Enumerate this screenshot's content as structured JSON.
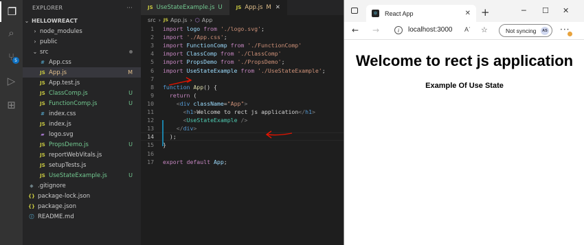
{
  "sidebar": {
    "title": "EXPLORER",
    "more": "···",
    "project": "HELLOWREACT",
    "items": [
      {
        "label": "node_modules",
        "icon": "chevron-right",
        "kind": "folder",
        "status": ""
      },
      {
        "label": "public",
        "icon": "chevron-right",
        "kind": "folder",
        "status": ""
      },
      {
        "label": "src",
        "icon": "chevron-down",
        "kind": "folder",
        "status": "dot"
      },
      {
        "label": "App.css",
        "icon": "#",
        "kind": "css",
        "status": ""
      },
      {
        "label": "App.js",
        "icon": "JS",
        "kind": "js",
        "status": "M"
      },
      {
        "label": "App.test.js",
        "icon": "JS",
        "kind": "js",
        "status": ""
      },
      {
        "label": "ClassComp.js",
        "icon": "JS",
        "kind": "js",
        "status": "U"
      },
      {
        "label": "FunctionComp.js",
        "icon": "JS",
        "kind": "js",
        "status": "U"
      },
      {
        "label": "index.css",
        "icon": "#",
        "kind": "css",
        "status": ""
      },
      {
        "label": "index.js",
        "icon": "JS",
        "kind": "js",
        "status": ""
      },
      {
        "label": "logo.svg",
        "icon": "svg",
        "kind": "svg",
        "status": ""
      },
      {
        "label": "PropsDemo.js",
        "icon": "JS",
        "kind": "js",
        "status": "U"
      },
      {
        "label": "reportWebVitals.js",
        "icon": "JS",
        "kind": "js",
        "status": ""
      },
      {
        "label": "setupTests.js",
        "icon": "JS",
        "kind": "js",
        "status": ""
      },
      {
        "label": "UseStateExample.js",
        "icon": "JS",
        "kind": "js",
        "status": "U"
      },
      {
        "label": ".gitignore",
        "icon": "git",
        "kind": "git",
        "status": ""
      },
      {
        "label": "package-lock.json",
        "icon": "{}",
        "kind": "json",
        "status": ""
      },
      {
        "label": "package.json",
        "icon": "{}",
        "kind": "json",
        "status": ""
      },
      {
        "label": "README.md",
        "icon": "ⓘ",
        "kind": "info",
        "status": ""
      }
    ]
  },
  "editor": {
    "tabs": [
      {
        "label": "UseStateExample.js",
        "mark": "U"
      },
      {
        "label": "App.js",
        "mark": "M"
      }
    ],
    "breadcrumb": {
      "folder": "src",
      "file": "App.js",
      "symbol": "App"
    },
    "current_line": 14,
    "lines": [
      "import logo from './logo.svg';",
      "import './App.css';",
      "import FunctionComp from './FunctionComp'",
      "import ClassComp from './ClassComp'",
      "import PropsDemo from './PropsDemo';",
      "import UseStateExample from './UseStateExample';",
      "",
      "function App() {",
      "  return (",
      "    <div className=\"App\">",
      "      <h1>Welcome to rect js application</h1>",
      "      <UseStateExample />",
      "    </div>",
      "  );",
      "}",
      "",
      "export default App;"
    ]
  },
  "browser": {
    "tab_title": "React App",
    "url": "localhost:3000",
    "sync_label": "Not syncing",
    "avatar": "AS",
    "read_aloud": "Aʾ",
    "page": {
      "heading": "Welcome to rect js application",
      "subheading": "Example Of Use State"
    }
  },
  "colors": {
    "activity_bar": "#333333",
    "sidebar": "#252526",
    "editor": "#1e1e1e",
    "untracked": "#73c991",
    "modified": "#e2c08d",
    "annotation": "#e51400"
  }
}
